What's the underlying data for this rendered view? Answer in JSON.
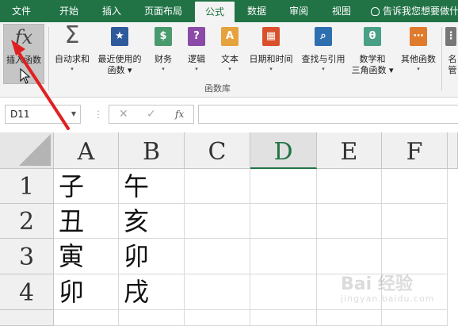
{
  "ribbon_tabs": [
    "文件",
    "开始",
    "插入",
    "页面布局",
    "公式",
    "数据",
    "审阅",
    "视图"
  ],
  "active_tab": "公式",
  "tell_me": "告诉我您想要做什么",
  "ribbon": {
    "insert_function": {
      "icon": "fx-icon",
      "label": "插入函数"
    },
    "buttons": [
      {
        "id": "autosum",
        "icon": "sigma-icon",
        "label": "自动求和",
        "color": "#555555",
        "glyph": "Σ"
      },
      {
        "id": "recent",
        "icon": "star-book-icon",
        "label": "最近使用的\n函数",
        "color": "#2e5a9c",
        "glyph": "★"
      },
      {
        "id": "financial",
        "icon": "coins-book-icon",
        "label": "财务",
        "color": "#4a9a6e",
        "glyph": "$"
      },
      {
        "id": "logical",
        "icon": "question-book-icon",
        "label": "逻辑",
        "color": "#8b4aa8",
        "glyph": "?"
      },
      {
        "id": "text",
        "icon": "text-book-icon",
        "label": "文本",
        "color": "#e6a23c",
        "glyph": "A"
      },
      {
        "id": "datetime",
        "icon": "calendar-book-icon",
        "label": "日期和时间",
        "color": "#d9512c",
        "glyph": "▦"
      },
      {
        "id": "lookup",
        "icon": "magnifier-book-icon",
        "label": "查找与引用",
        "color": "#2e6fb0",
        "glyph": "⌕"
      },
      {
        "id": "math",
        "icon": "theta-book-icon",
        "label": "数学和\n三角函数",
        "color": "#4aa087",
        "glyph": "θ"
      },
      {
        "id": "more",
        "icon": "more-book-icon",
        "label": "其他函数",
        "color": "#e07b2e",
        "glyph": "⋯"
      },
      {
        "id": "namemgr",
        "icon": "name-manager-icon",
        "label": "名\n管",
        "color": "#777777",
        "glyph": "⋮"
      }
    ],
    "group_label": "函数库"
  },
  "formula_bar": {
    "name_box": "D11",
    "cancel": "✕",
    "enter": "✓",
    "fx": "fx",
    "formula": ""
  },
  "columns": [
    "A",
    "B",
    "C",
    "D",
    "E",
    "F"
  ],
  "selected_column": "D",
  "rows": [
    {
      "num": "1",
      "cells": [
        "子",
        "午",
        "",
        "",
        "",
        ""
      ]
    },
    {
      "num": "2",
      "cells": [
        "丑",
        "亥",
        "",
        "",
        "",
        ""
      ]
    },
    {
      "num": "3",
      "cells": [
        "寅",
        "卯",
        "",
        "",
        "",
        ""
      ]
    },
    {
      "num": "4",
      "cells": [
        "卯",
        "戌",
        "",
        "",
        "",
        ""
      ]
    },
    {
      "num": "",
      "cells": [
        "",
        "",
        "",
        "",
        "",
        ""
      ]
    }
  ],
  "watermark": {
    "text": "Bai 经验",
    "sub": "jingyan.baidu.com"
  },
  "colors": {
    "ribbon_green": "#217346",
    "annotation_red": "#e02020"
  }
}
